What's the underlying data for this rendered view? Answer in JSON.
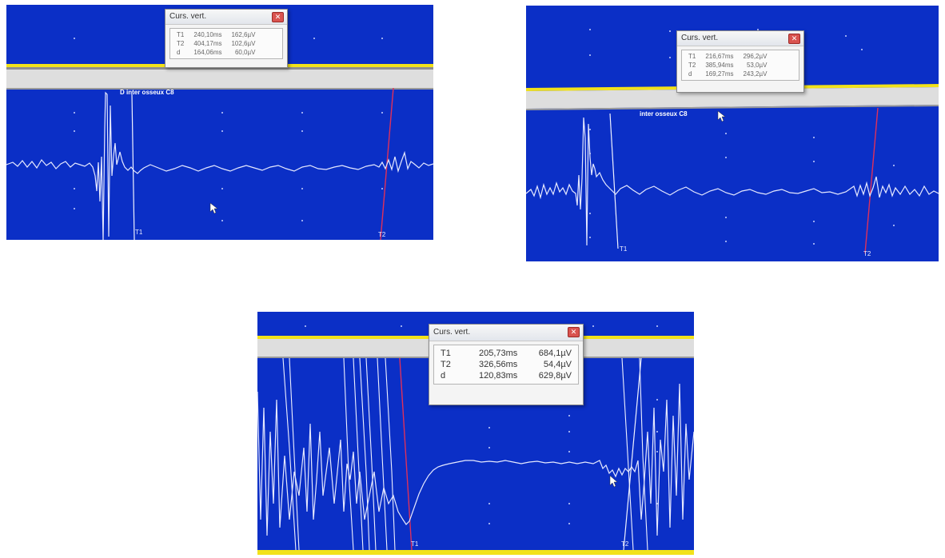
{
  "photos": [
    {
      "window_title": "Curs. vert.",
      "channel_label": "D inter osseux C8",
      "rows": [
        {
          "label": "T1",
          "time": "240,10ms",
          "amplitude": "162,6µV"
        },
        {
          "label": "T2",
          "time": "404,17ms",
          "amplitude": "102,6µV"
        },
        {
          "label": "d",
          "time": "164,06ms",
          "amplitude": "60,0µV"
        }
      ],
      "cursor_1_label": "T1",
      "cursor_2_label": "T2"
    },
    {
      "window_title": "Curs. vert.",
      "channel_label": "inter osseux C8",
      "rows": [
        {
          "label": "T1",
          "time": "216,67ms",
          "amplitude": "296,2µV"
        },
        {
          "label": "T2",
          "time": "385,94ms",
          "amplitude": "53,0µV"
        },
        {
          "label": "d",
          "time": "169,27ms",
          "amplitude": "243,2µV"
        }
      ],
      "cursor_1_label": "T1",
      "cursor_2_label": "T2"
    },
    {
      "window_title": "Curs. vert.",
      "rows": [
        {
          "label": "T1",
          "time": "205,73ms",
          "amplitude": "684,1µV"
        },
        {
          "label": "T2",
          "time": "326,56ms",
          "amplitude": "54,4µV"
        },
        {
          "label": "d",
          "time": "120,83ms",
          "amplitude": "629,8µV"
        }
      ],
      "cursor_1_label": "T1",
      "cursor_2_label": "T2"
    }
  ],
  "colors": {
    "screen_blue": "#0b2fc6",
    "trace": "#e6e9ff",
    "cursor_t2": "#e0305a",
    "band_yellow": "#f2e21a"
  },
  "icons": [
    "mouse-pointer-icon",
    "close-icon"
  ]
}
